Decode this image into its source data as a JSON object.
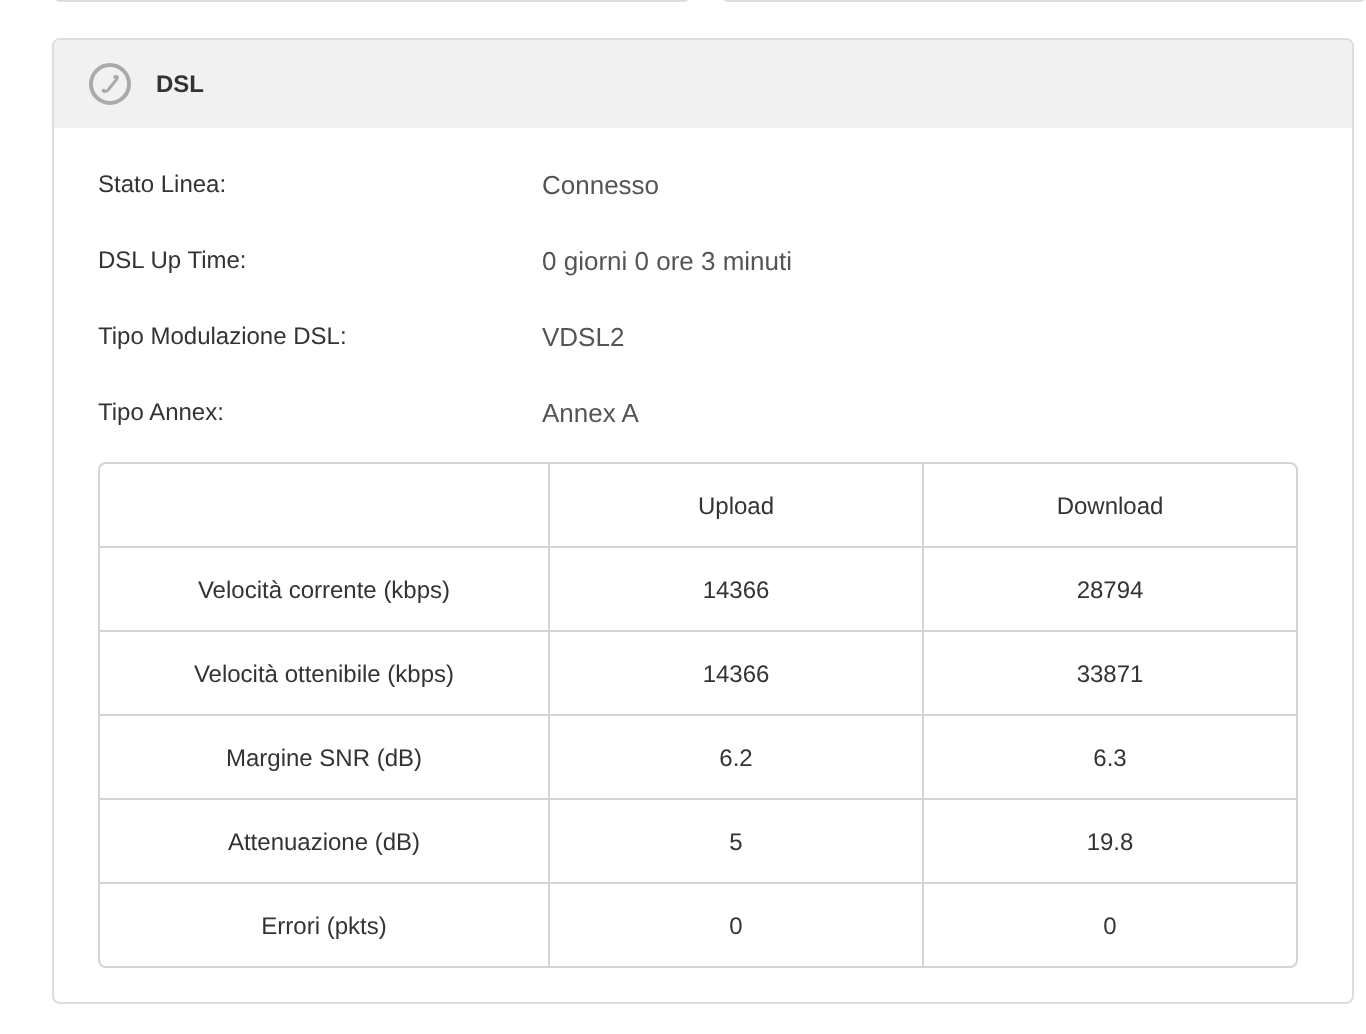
{
  "panel": {
    "title": "DSL"
  },
  "fields": [
    {
      "label": "Stato Linea:",
      "value": "Connesso"
    },
    {
      "label": "DSL Up Time:",
      "value": "0 giorni 0 ore 3 minuti"
    },
    {
      "label": "Tipo Modulazione DSL:",
      "value": "VDSL2"
    },
    {
      "label": "Tipo Annex:",
      "value": "Annex A"
    }
  ],
  "table": {
    "columns": [
      "Upload",
      "Download"
    ],
    "rows": [
      {
        "label": "Velocità corrente (kbps)",
        "cells": [
          "14366",
          "28794"
        ]
      },
      {
        "label": "Velocità ottenibile (kbps)",
        "cells": [
          "14366",
          "33871"
        ]
      },
      {
        "label": "Margine SNR (dB)",
        "cells": [
          "6.2",
          "6.3"
        ]
      },
      {
        "label": "Attenuazione (dB)",
        "cells": [
          "5",
          "19.8"
        ]
      },
      {
        "label": "Errori (pkts)",
        "cells": [
          "0",
          "0"
        ]
      }
    ]
  }
}
